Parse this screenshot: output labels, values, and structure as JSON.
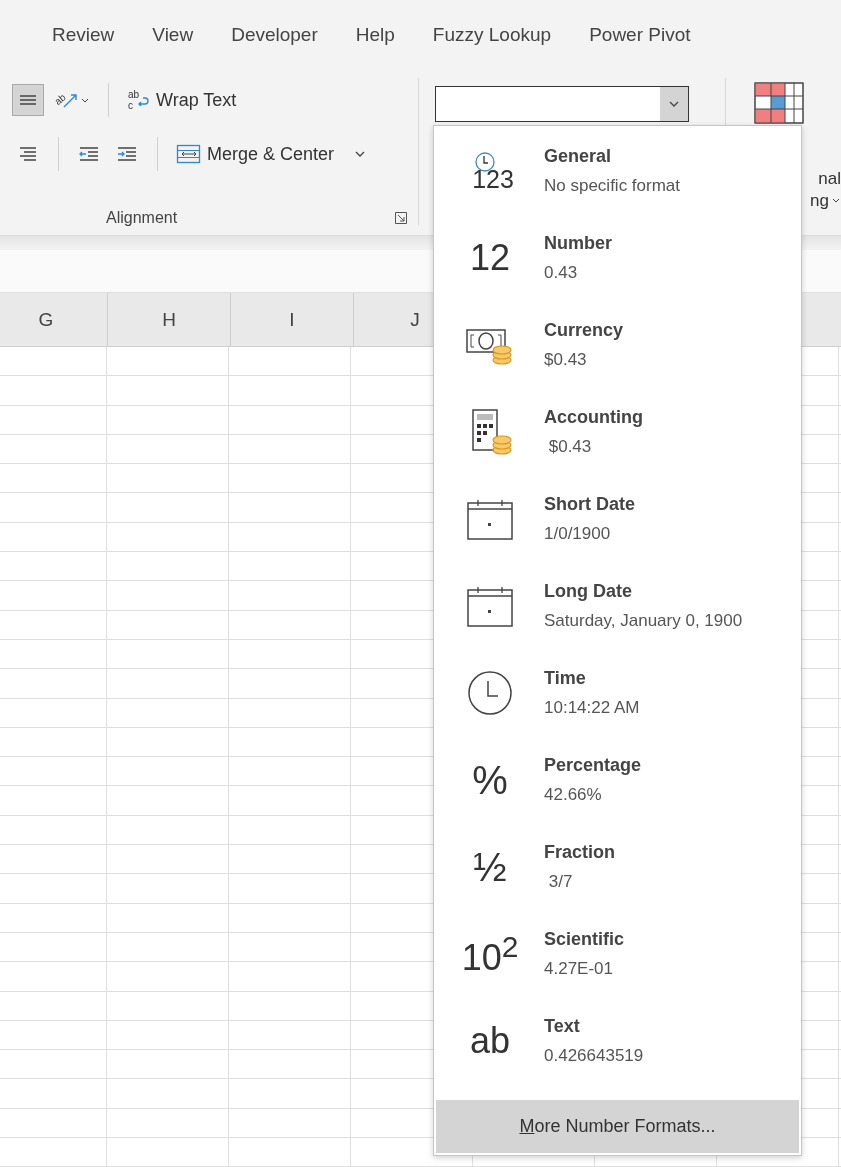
{
  "tabs": [
    {
      "label": "Review"
    },
    {
      "label": "View"
    },
    {
      "label": "Developer"
    },
    {
      "label": "Help"
    },
    {
      "label": "Fuzzy Lookup"
    },
    {
      "label": "Power Pivot"
    }
  ],
  "alignment": {
    "row1": [
      {
        "kind": "align-middle",
        "selected": true
      },
      {
        "kind": "orientation",
        "glyph": "ab",
        "selected": false
      }
    ],
    "row2": [
      {
        "kind": "align-right",
        "selected": false
      },
      {
        "kind": "decrease-indent",
        "selected": false
      },
      {
        "kind": "increase-indent",
        "selected": false
      }
    ],
    "wrap_glyph_top": "ab",
    "wrap_glyph_bottom": "c",
    "wrap_text": "Wrap Text",
    "merge_center": "Merge & Center",
    "label": "Alignment"
  },
  "conditional_formatting": {
    "line1": "nal",
    "line2": "ng"
  },
  "columns": [
    "G",
    "H",
    "I",
    "J"
  ],
  "formats": [
    {
      "kind": "general",
      "glyph": "123",
      "name": "General",
      "example": "No specific format"
    },
    {
      "kind": "number",
      "glyph": "12",
      "name": "Number",
      "example": "0.43"
    },
    {
      "kind": "currency",
      "name": "Currency",
      "example": "$0.43"
    },
    {
      "kind": "accounting",
      "name": "Accounting",
      "example": " $0.43"
    },
    {
      "kind": "short-date",
      "name": "Short Date",
      "example": "1/0/1900"
    },
    {
      "kind": "long-date",
      "name": "Long Date",
      "example": "Saturday, January 0, 1900"
    },
    {
      "kind": "time",
      "name": "Time",
      "example": "10:14:22 AM"
    },
    {
      "kind": "percentage",
      "glyph": "%",
      "name": "Percentage",
      "example": "42.66%"
    },
    {
      "kind": "fraction",
      "glyph": "½",
      "name": "Fraction",
      "example": " 3/7"
    },
    {
      "kind": "scientific",
      "glyph": "10$^{2}$",
      "name": "Scientific",
      "example": "4.27E-01"
    },
    {
      "kind": "text",
      "glyph": "ab",
      "name": "Text",
      "example": "0.426643519"
    }
  ],
  "more_formats": "More Number Formats..."
}
